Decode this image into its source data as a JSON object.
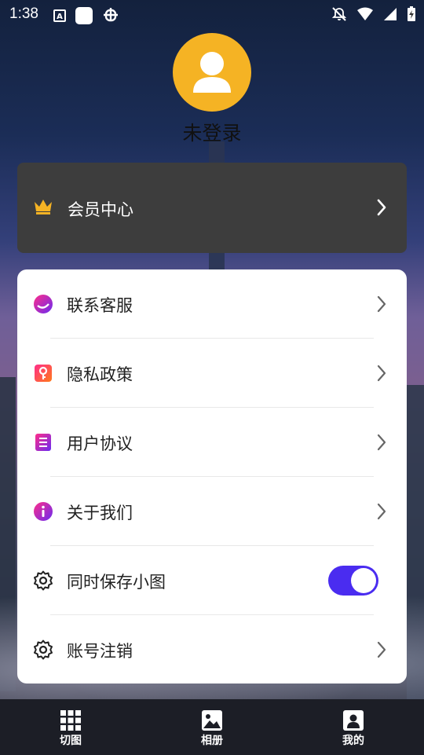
{
  "status_bar": {
    "time": "1:38",
    "left_icons": [
      "a-icon",
      "white-square-icon",
      "bug-icon"
    ],
    "right_icons": [
      "bell-off-icon",
      "wifi-icon",
      "signal-icon",
      "battery-charging-icon"
    ]
  },
  "profile": {
    "login_status": "未登录",
    "avatar_color": "#f5b324"
  },
  "vip": {
    "label": "会员中心",
    "icon": "crown-icon",
    "icon_color": "#f5b324"
  },
  "menu": {
    "items": [
      {
        "label": "联系客服",
        "icon": "service-icon",
        "control": "chevron"
      },
      {
        "label": "隐私政策",
        "icon": "privacy-icon",
        "control": "chevron"
      },
      {
        "label": "用户协议",
        "icon": "agreement-icon",
        "control": "chevron"
      },
      {
        "label": "关于我们",
        "icon": "info-icon",
        "control": "chevron"
      },
      {
        "label": "同时保存小图",
        "icon": "gear-icon",
        "control": "toggle",
        "toggle_on": true
      },
      {
        "label": "账号注销",
        "icon": "gear-icon",
        "control": "chevron"
      }
    ],
    "accent_color": "#4a2cf0",
    "icon_gradient": [
      "#ff2d8a",
      "#ff7a1a"
    ]
  },
  "tab_bar": {
    "tabs": [
      {
        "label": "切图",
        "icon": "grid-icon"
      },
      {
        "label": "相册",
        "icon": "image-icon"
      },
      {
        "label": "我的",
        "icon": "person-card-icon",
        "active": true
      }
    ]
  }
}
